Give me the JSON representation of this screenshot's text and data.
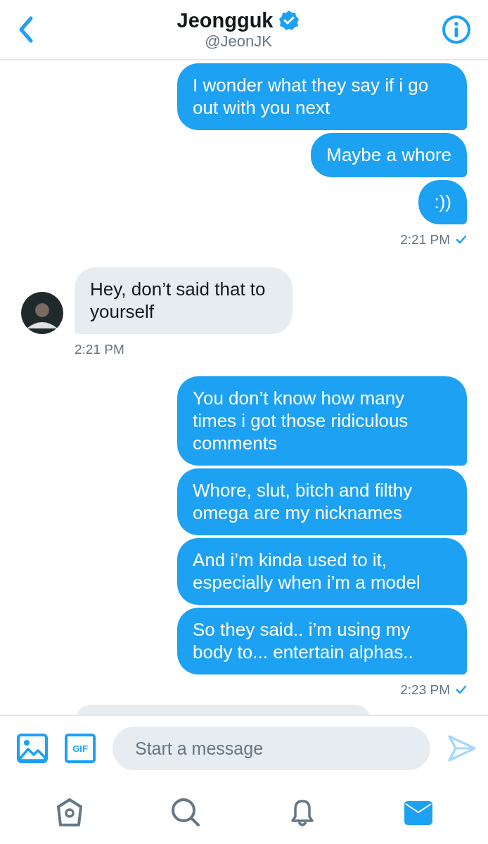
{
  "header": {
    "name": "Jeongguk",
    "verified": true,
    "handle": "@JeonJK"
  },
  "groups": [
    {
      "kind": "sent",
      "bubbles": [
        "I wonder what they say if i go out with you next",
        "Maybe a whore",
        ":))"
      ],
      "time": "2:21 PM",
      "read": true
    },
    {
      "kind": "received",
      "bubbles": [
        "Hey, don’t said that to yourself"
      ],
      "time": "2:21 PM"
    },
    {
      "kind": "sent",
      "bubbles": [
        "You don’t know how many times i got those ridiculous comments",
        "Whore, slut, bitch and filthy omega are my nicknames",
        "And i’m kinda used to it, especially when i’m a model",
        "So they said.. i’m using my body to... entertain alphas.."
      ],
      "time": "2:23 PM",
      "read": true
    }
  ],
  "more_below": true,
  "composer": {
    "gif_label": "GIF",
    "placeholder": "Start a message"
  },
  "tabs": [
    {
      "kind": "home",
      "selected": false
    },
    {
      "kind": "search",
      "selected": false
    },
    {
      "kind": "notifications",
      "selected": false
    },
    {
      "kind": "messages",
      "selected": true
    }
  ]
}
